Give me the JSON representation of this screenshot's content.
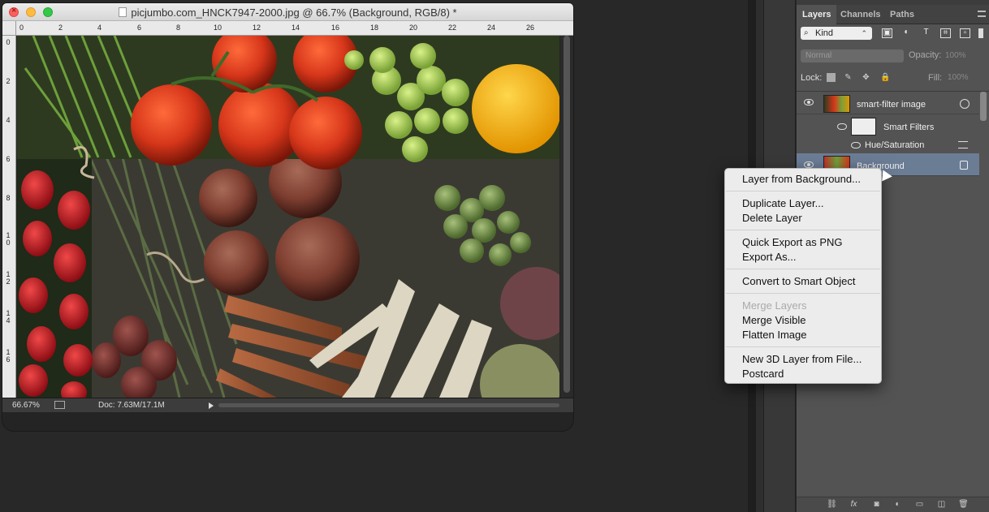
{
  "window": {
    "title": "picjumbo.com_HNCK7947-2000.jpg @ 66.7% (Background, RGB/8) *"
  },
  "rulers": {
    "top_ticks": [
      "0",
      "2",
      "4",
      "6",
      "8",
      "10",
      "12",
      "14",
      "16",
      "18",
      "20",
      "22",
      "24",
      "26"
    ],
    "left_ticks": [
      "0",
      "2",
      "4",
      "6",
      "8",
      "1\n0",
      "1\n2",
      "1\n4",
      "1\n6"
    ]
  },
  "status": {
    "zoom": "66.67%",
    "doc_size": "Doc: 7.63M/17.1M"
  },
  "layers_panel": {
    "tabs": [
      "Layers",
      "Channels",
      "Paths"
    ],
    "filter_kind": "Kind",
    "blend_mode": "Normal",
    "opacity_label": "Opacity:",
    "opacity_value": "100%",
    "lock_label": "Lock:",
    "fill_label": "Fill:",
    "fill_value": "100%",
    "layers": [
      {
        "name": "smart-filter image",
        "visible": true
      },
      {
        "name": "Smart Filters",
        "visible": true
      },
      {
        "name": "Hue/Saturation",
        "visible": true
      },
      {
        "name": "Background",
        "visible": true,
        "selected": true,
        "locked": true
      }
    ]
  },
  "context_menu": {
    "items": [
      {
        "label": "Layer from Background...",
        "enabled": true
      },
      {
        "label": "Duplicate Layer...",
        "enabled": true
      },
      {
        "label": "Delete Layer",
        "enabled": true
      },
      {
        "label": "Quick Export as PNG",
        "enabled": true
      },
      {
        "label": "Export As...",
        "enabled": true
      },
      {
        "label": "Convert to Smart Object",
        "enabled": true
      },
      {
        "label": "Merge Layers",
        "enabled": false
      },
      {
        "label": "Merge Visible",
        "enabled": true
      },
      {
        "label": "Flatten Image",
        "enabled": true
      },
      {
        "label": "New 3D Layer from File...",
        "enabled": true
      },
      {
        "label": "Postcard",
        "enabled": true
      }
    ]
  },
  "colors": {
    "selected_layer": "#6b7c95",
    "panel_bg": "#535353",
    "menu_bg": "#ececec"
  }
}
